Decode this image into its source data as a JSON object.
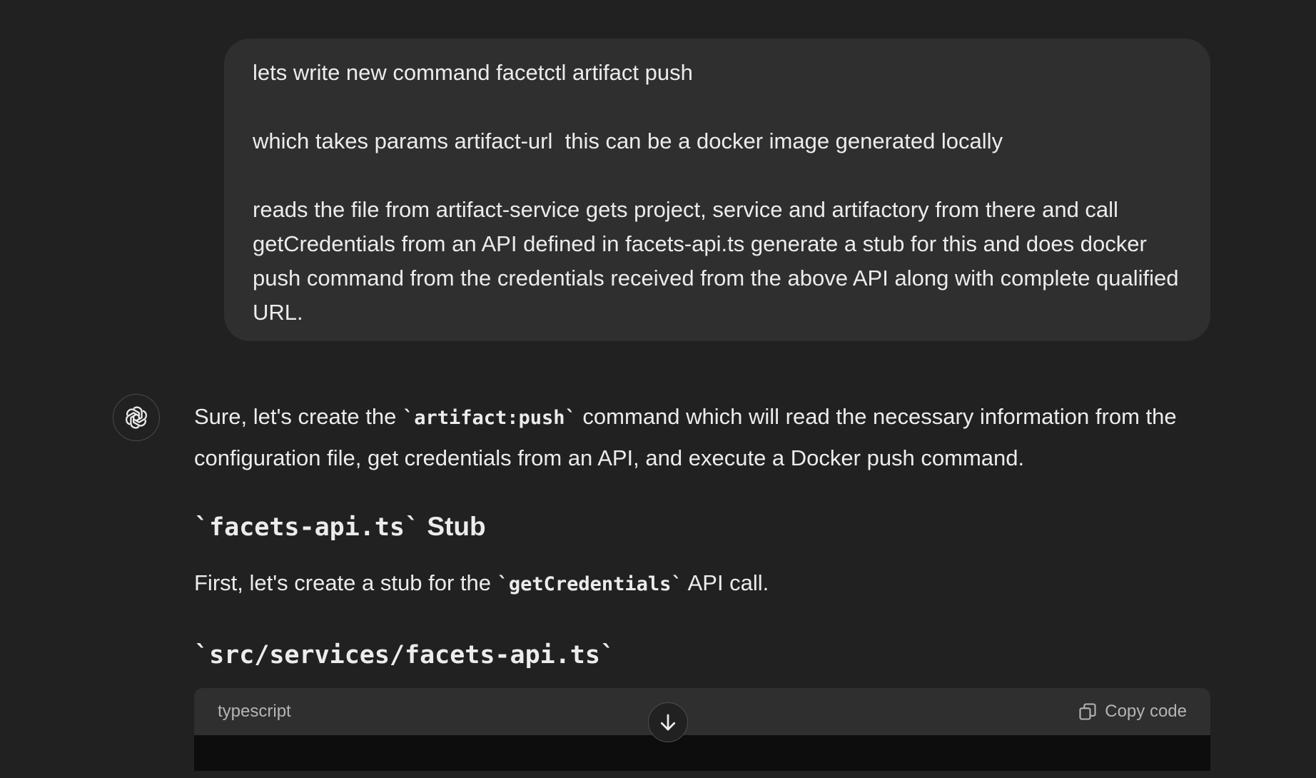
{
  "user_message": {
    "paragraphs": [
      "lets write new command facetctl artifact push",
      "which takes params artifact-url  this can be a docker image generated locally",
      "reads the file from artifact-service gets project, service and artifactory from there and call getCredentials from an API defined in facets-api.ts generate a stub for this and does docker push command from the credentials received from the above API along with complete qualified URL."
    ]
  },
  "assistant": {
    "avatar_icon": "openai-logo-icon",
    "intro": {
      "before": "Sure, let's create the ",
      "code": "`artifact:push`",
      "after": " command which will read the necessary information from the configuration file, get credentials from an API, and execute a Docker push command."
    },
    "heading1": {
      "code": "`facets-api.ts`",
      "text": " Stub"
    },
    "para2": {
      "before": "First, let's create a stub for the ",
      "code": "`getCredentials`",
      "after": " API call."
    },
    "heading2": {
      "code": "`src/services/facets-api.ts`"
    },
    "code_block": {
      "language": "typescript",
      "copy_label": "Copy code"
    }
  },
  "scroll_button": {
    "icon": "arrow-down-icon"
  }
}
